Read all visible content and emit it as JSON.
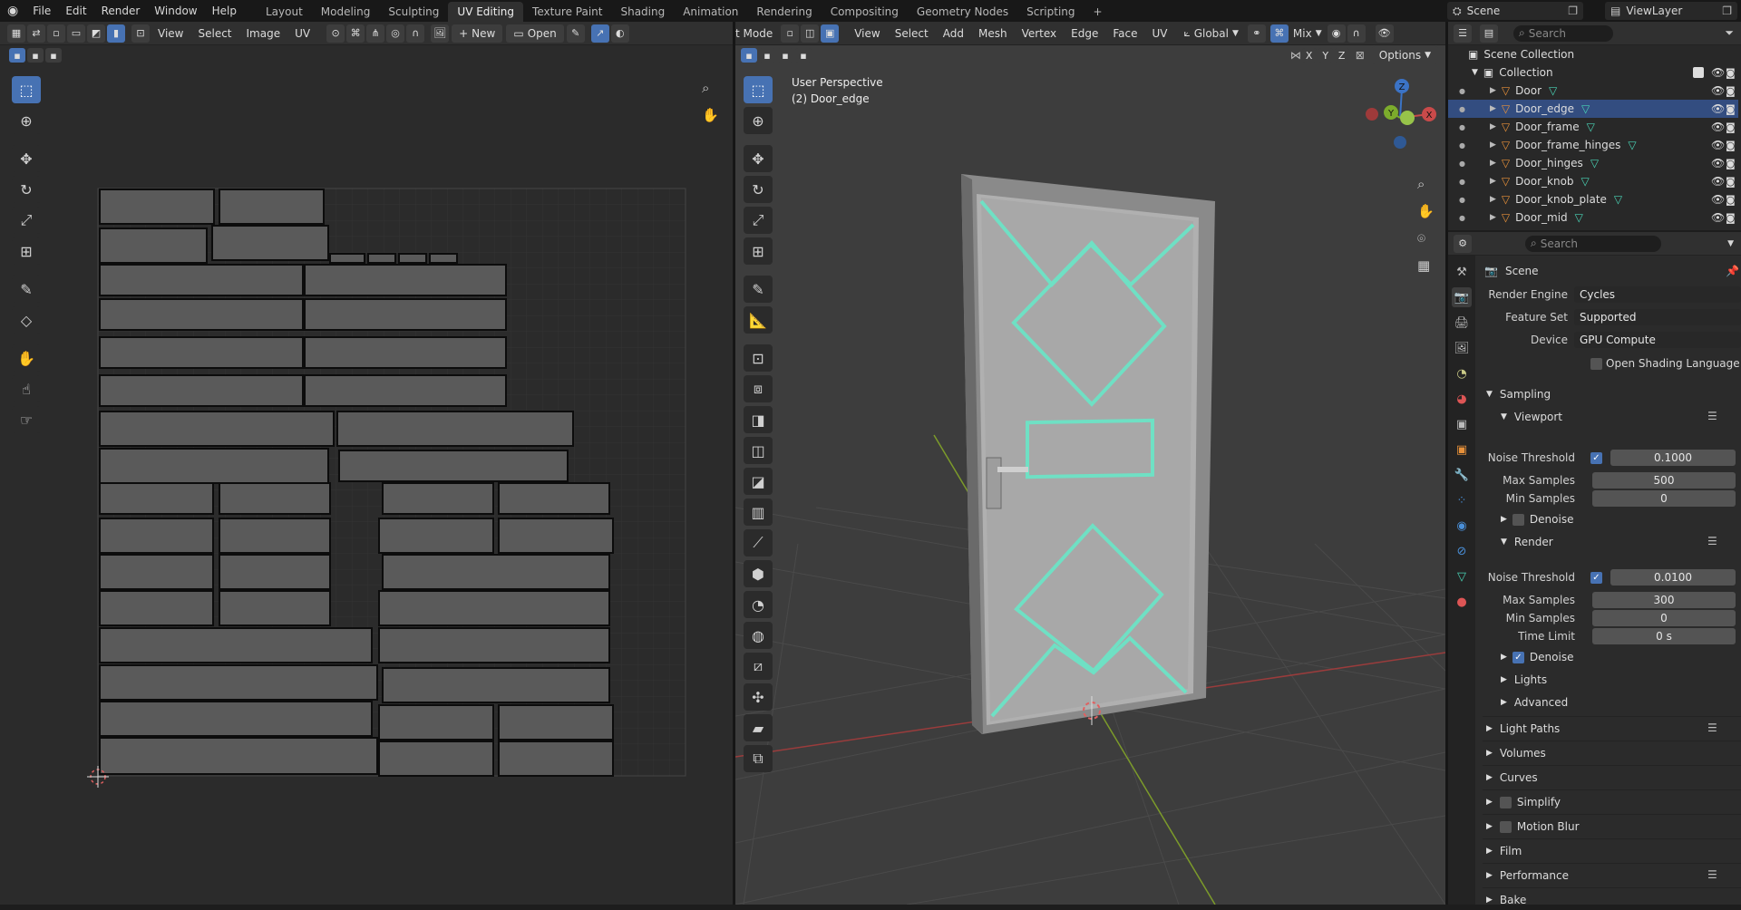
{
  "topbar": {
    "menus": [
      "File",
      "Edit",
      "Render",
      "Window",
      "Help"
    ],
    "workspaces": [
      "Layout",
      "Modeling",
      "Sculpting",
      "UV Editing",
      "Texture Paint",
      "Shading",
      "Animation",
      "Rendering",
      "Compositing",
      "Geometry Nodes",
      "Scripting"
    ],
    "active_workspace": "UV Editing",
    "add_tab": "+",
    "scene_label": "Scene",
    "view_layer_label": "ViewLayer"
  },
  "uv_editor": {
    "menus": [
      "View",
      "Select",
      "Image",
      "UV"
    ],
    "new_label": "New",
    "open_label": "Open"
  },
  "viewport": {
    "mode_label": "t Mode",
    "menus": [
      "View",
      "Select",
      "Add",
      "Mesh",
      "Vertex",
      "Edge",
      "Face",
      "UV"
    ],
    "transform_orientation": "Global",
    "pivot_label": "Mix",
    "axis_x": "X",
    "axis_y": "Y",
    "axis_z": "Z",
    "options_label": "Options",
    "overlay_line1": "User Perspective",
    "overlay_line2": "(2) Door_edge",
    "gizmo_x": "X",
    "gizmo_y": "Y",
    "gizmo_z": "Z"
  },
  "outliner": {
    "search_placeholder": "Search",
    "scene_collection": "Scene Collection",
    "collection": "Collection",
    "items": [
      "Door",
      "Door_edge",
      "Door_frame",
      "Door_frame_hinges",
      "Door_hinges",
      "Door_knob",
      "Door_knob_plate",
      "Door_mid"
    ],
    "selected": "Door_edge"
  },
  "properties": {
    "search_placeholder": "Search",
    "context": "Scene",
    "render_engine_label": "Render Engine",
    "render_engine": "Cycles",
    "feature_set_label": "Feature Set",
    "feature_set": "Supported",
    "device_label": "Device",
    "device": "GPU Compute",
    "osl_label": "Open Shading Language",
    "sampling": "Sampling",
    "viewport": "Viewport",
    "vp_noise_label": "Noise Threshold",
    "vp_noise": "0.1000",
    "vp_max_label": "Max Samples",
    "vp_max": "500",
    "vp_min_label": "Min Samples",
    "vp_min": "0",
    "vp_denoise": "Denoise",
    "render": "Render",
    "r_noise_label": "Noise Threshold",
    "r_noise": "0.0100",
    "r_max_label": "Max Samples",
    "r_max": "300",
    "r_min_label": "Min Samples",
    "r_min": "0",
    "r_time_label": "Time Limit",
    "r_time": "0 s",
    "r_denoise": "Denoise",
    "lights": "Lights",
    "advanced": "Advanced",
    "panels": [
      "Light Paths",
      "Volumes",
      "Curves",
      "Simplify",
      "Motion Blur",
      "Film",
      "Performance",
      "Bake"
    ]
  },
  "colors": {
    "accent": "#4772b3",
    "selection": "#334d80",
    "edge_highlight": "#6fe0c4",
    "object_orange": "#e7913a"
  }
}
